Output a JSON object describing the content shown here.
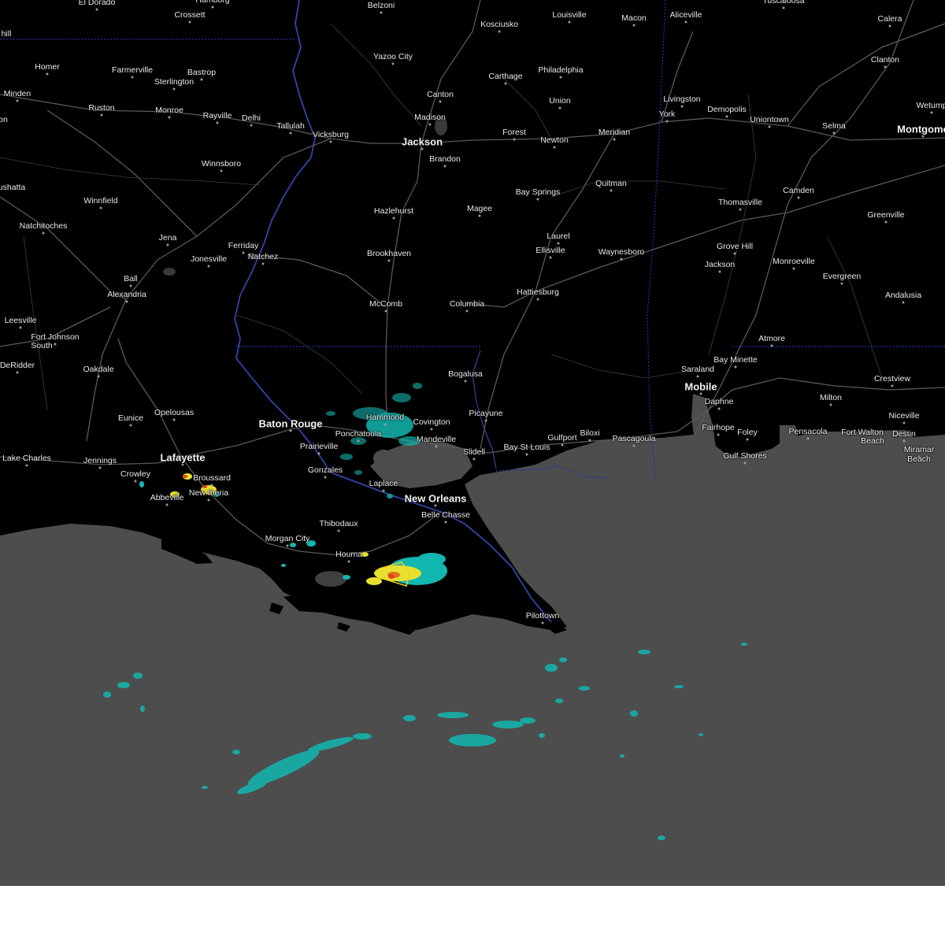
{
  "map": {
    "colors": {
      "land": "#000000",
      "water": "#4d4d4d",
      "roads": "#5a5a5a",
      "state_border": "#2233aa",
      "river": "#3344aa",
      "radar_light": "#12b7b0",
      "radar_mid": "#e8e030",
      "radar_heavy": "#e04020",
      "warning_outline": "#f0d020"
    },
    "cities": [
      {
        "id": "el-dorado",
        "name": "El Dorado"
      },
      {
        "id": "hamburg",
        "name": "Hamburg"
      },
      {
        "id": "crossett",
        "name": "Crossett"
      },
      {
        "id": "belzoni",
        "name": "Belzoni"
      },
      {
        "id": "kosciusko",
        "name": "Kosciusko"
      },
      {
        "id": "louisville",
        "name": "Louisville"
      },
      {
        "id": "macon",
        "name": "Macon"
      },
      {
        "id": "aliceville",
        "name": "Aliceville"
      },
      {
        "id": "tuscaloosa",
        "name": "Tuscaloosa"
      },
      {
        "id": "calera",
        "name": "Calera"
      },
      {
        "id": "hill",
        "name": "hill"
      },
      {
        "id": "yazoo-city",
        "name": "Yazoo City"
      },
      {
        "id": "clanton",
        "name": "Clanton"
      },
      {
        "id": "homer",
        "name": "Homer"
      },
      {
        "id": "farmerville",
        "name": "Farmerville"
      },
      {
        "id": "bastrop",
        "name": "Bastrop"
      },
      {
        "id": "carthage",
        "name": "Carthage"
      },
      {
        "id": "philadelphia",
        "name": "Philadelphia"
      },
      {
        "id": "sterlington",
        "name": "Sterlington"
      },
      {
        "id": "minden",
        "name": "Minden"
      },
      {
        "id": "canton",
        "name": "Canton"
      },
      {
        "id": "livingston",
        "name": "Livingston"
      },
      {
        "id": "union",
        "name": "Union"
      },
      {
        "id": "wetumpka",
        "name": "Wetump"
      },
      {
        "id": "ruston",
        "name": "Ruston"
      },
      {
        "id": "monroe",
        "name": "Monroe"
      },
      {
        "id": "demopolis",
        "name": "Demopolis"
      },
      {
        "id": "madison",
        "name": "Madison"
      },
      {
        "id": "rayville",
        "name": "Rayville"
      },
      {
        "id": "york",
        "name": "York"
      },
      {
        "id": "delhi",
        "name": "Delhi"
      },
      {
        "id": "uniontown",
        "name": "Uniontown"
      },
      {
        "id": "on",
        "name": "on"
      },
      {
        "id": "tallulah",
        "name": "Tallulah"
      },
      {
        "id": "selma",
        "name": "Selma"
      },
      {
        "id": "montgomery",
        "name": "Montgome"
      },
      {
        "id": "forest",
        "name": "Forest"
      },
      {
        "id": "vicksburg",
        "name": "Vicksburg"
      },
      {
        "id": "meridian",
        "name": "Meridian"
      },
      {
        "id": "jackson-ms",
        "name": "Jackson"
      },
      {
        "id": "newton",
        "name": "Newton"
      },
      {
        "id": "brandon",
        "name": "Brandon"
      },
      {
        "id": "winnsboro",
        "name": "Winnsboro"
      },
      {
        "id": "quitman",
        "name": "Quitman"
      },
      {
        "id": "camden",
        "name": "Camden"
      },
      {
        "id": "bay-springs",
        "name": "Bay Springs"
      },
      {
        "id": "natchitoches-w",
        "name": "ushatta"
      },
      {
        "id": "winnfield",
        "name": "Winnfield"
      },
      {
        "id": "thomasville",
        "name": "Thomasville"
      },
      {
        "id": "hazlehurst",
        "name": "Hazlehurst"
      },
      {
        "id": "magee",
        "name": "Magee"
      },
      {
        "id": "greenville",
        "name": "Greenville"
      },
      {
        "id": "natchitoches",
        "name": "Natchitoches"
      },
      {
        "id": "laurel",
        "name": "Laurel"
      },
      {
        "id": "jena",
        "name": "Jena"
      },
      {
        "id": "ferriday",
        "name": "Ferriday"
      },
      {
        "id": "grove-hill",
        "name": "Grove Hill"
      },
      {
        "id": "ellisville",
        "name": "Ellisville"
      },
      {
        "id": "waynesboro",
        "name": "Waynesboro"
      },
      {
        "id": "brookhaven",
        "name": "Brookhaven"
      },
      {
        "id": "natchez",
        "name": "Natchez"
      },
      {
        "id": "jonesville",
        "name": "Jonesville"
      },
      {
        "id": "monroeville",
        "name": "Monroeville"
      },
      {
        "id": "jackson-al",
        "name": "Jackson"
      },
      {
        "id": "ball",
        "name": "Ball"
      },
      {
        "id": "evergreen",
        "name": "Evergreen"
      },
      {
        "id": "alexandria",
        "name": "Alexandria"
      },
      {
        "id": "hattiesburg",
        "name": "Hattiesburg"
      },
      {
        "id": "andalusia",
        "name": "Andalusia"
      },
      {
        "id": "mccomb",
        "name": "McComb"
      },
      {
        "id": "columbia",
        "name": "Columbia"
      },
      {
        "id": "leesville",
        "name": "Leesville"
      },
      {
        "id": "fort-johnson",
        "name": "Fort Johnson"
      },
      {
        "id": "fort-johnson-2",
        "name": "South"
      },
      {
        "id": "atmore",
        "name": "Atmore"
      },
      {
        "id": "bay-minette",
        "name": "Bay Minette"
      },
      {
        "id": "deridder",
        "name": "DeRidder"
      },
      {
        "id": "oakdale",
        "name": "Oakdale"
      },
      {
        "id": "saraland",
        "name": "Saraland"
      },
      {
        "id": "bogalusa",
        "name": "Bogalusa"
      },
      {
        "id": "crestview",
        "name": "Crestview"
      },
      {
        "id": "mobile",
        "name": "Mobile"
      },
      {
        "id": "milton",
        "name": "Milton"
      },
      {
        "id": "daphne",
        "name": "Daphne"
      },
      {
        "id": "hammond",
        "name": "Hammond"
      },
      {
        "id": "picayune",
        "name": "Picayune"
      },
      {
        "id": "niceville",
        "name": "Niceville"
      },
      {
        "id": "eunice",
        "name": "Eunice"
      },
      {
        "id": "opelousas",
        "name": "Opelousas"
      },
      {
        "id": "baton-rouge",
        "name": "Baton Rouge"
      },
      {
        "id": "covington",
        "name": "Covington"
      },
      {
        "id": "fairhope",
        "name": "Fairhope"
      },
      {
        "id": "foley",
        "name": "Foley"
      },
      {
        "id": "pensacola",
        "name": "Pensacola"
      },
      {
        "id": "fort-walton",
        "name": "Fort Walton"
      },
      {
        "id": "fort-walton-2",
        "name": "Beach"
      },
      {
        "id": "destin",
        "name": "Destin"
      },
      {
        "id": "ponchatoula",
        "name": "Ponchatoula"
      },
      {
        "id": "biloxi",
        "name": "Biloxi"
      },
      {
        "id": "mandeville",
        "name": "Mandeville"
      },
      {
        "id": "gulfport",
        "name": "Gulfport"
      },
      {
        "id": "pascagoula",
        "name": "Pascagoula"
      },
      {
        "id": "prairieville",
        "name": "Prairieville"
      },
      {
        "id": "bay-st-louis",
        "name": "Bay St Louis"
      },
      {
        "id": "slidell",
        "name": "Slidell"
      },
      {
        "id": "miramar",
        "name": "Miramar"
      },
      {
        "id": "miramar-2",
        "name": "Beach"
      },
      {
        "id": "gulf-shores",
        "name": "Gulf Shores"
      },
      {
        "id": "lafayette",
        "name": "Lafayette"
      },
      {
        "id": "lake-charles",
        "name": "Lake Charles"
      },
      {
        "id": "jennings",
        "name": "Jennings"
      },
      {
        "id": "gonzales",
        "name": "Gonzales"
      },
      {
        "id": "crowley",
        "name": "Crowley"
      },
      {
        "id": "broussard",
        "name": "Broussard"
      },
      {
        "id": "laplace",
        "name": "Laplace"
      },
      {
        "id": "new-iberia",
        "name": "New Iberia"
      },
      {
        "id": "abbeville",
        "name": "Abbeville"
      },
      {
        "id": "new-orleans",
        "name": "New Orleans"
      },
      {
        "id": "belle-chasse",
        "name": "Belle Chasse"
      },
      {
        "id": "thibodaux",
        "name": "Thibodaux"
      },
      {
        "id": "morgan-city",
        "name": "Morgan City"
      },
      {
        "id": "houma",
        "name": "Houma"
      },
      {
        "id": "pilottown",
        "name": "Pilottown"
      }
    ]
  }
}
